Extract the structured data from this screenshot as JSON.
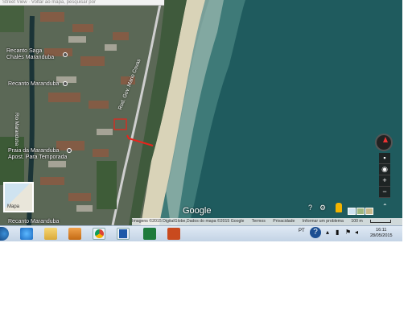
{
  "map": {
    "search_placeholder": "Street View · Voltar ao mapa, pesquisar por",
    "places": [
      {
        "name": "Recanto Saga\nChalés Maranduba"
      },
      {
        "name": "Recanto Maranduba"
      },
      {
        "name": "Praia da Maranduba\nApost. Para Temporada"
      },
      {
        "name": "Recanto Maranduba"
      }
    ],
    "road_label": "Rod. Gov. Mário Covas",
    "street_label": "Rio Maranduba",
    "google_logo": "Google",
    "mapa_thumb_label": "Mapa",
    "controls": {
      "help_icon": "?",
      "settings_icon": "⚙",
      "expand_icon": "⌃",
      "zoom_buttons": [
        "▪",
        "◉",
        "+",
        "−"
      ]
    },
    "footer": {
      "imagery": "Imagens ©2015 DigitalGlobe,Dados do mapa ©2015 Google",
      "terms": "Termos",
      "privacy": "Privacidade",
      "report": "Informar um problema",
      "scale": "100 m"
    },
    "colors": {
      "ocean": "#1f5b5e",
      "sand": "#d9d3b8",
      "route": "#e8241c"
    }
  },
  "taskbar": {
    "language": "PT",
    "time": "16:11",
    "date": "28/05/2015",
    "apps": [
      "windows-start",
      "internet-explorer",
      "file-explorer",
      "media-player",
      "chrome",
      "outlook",
      "excel",
      "presentation"
    ]
  }
}
